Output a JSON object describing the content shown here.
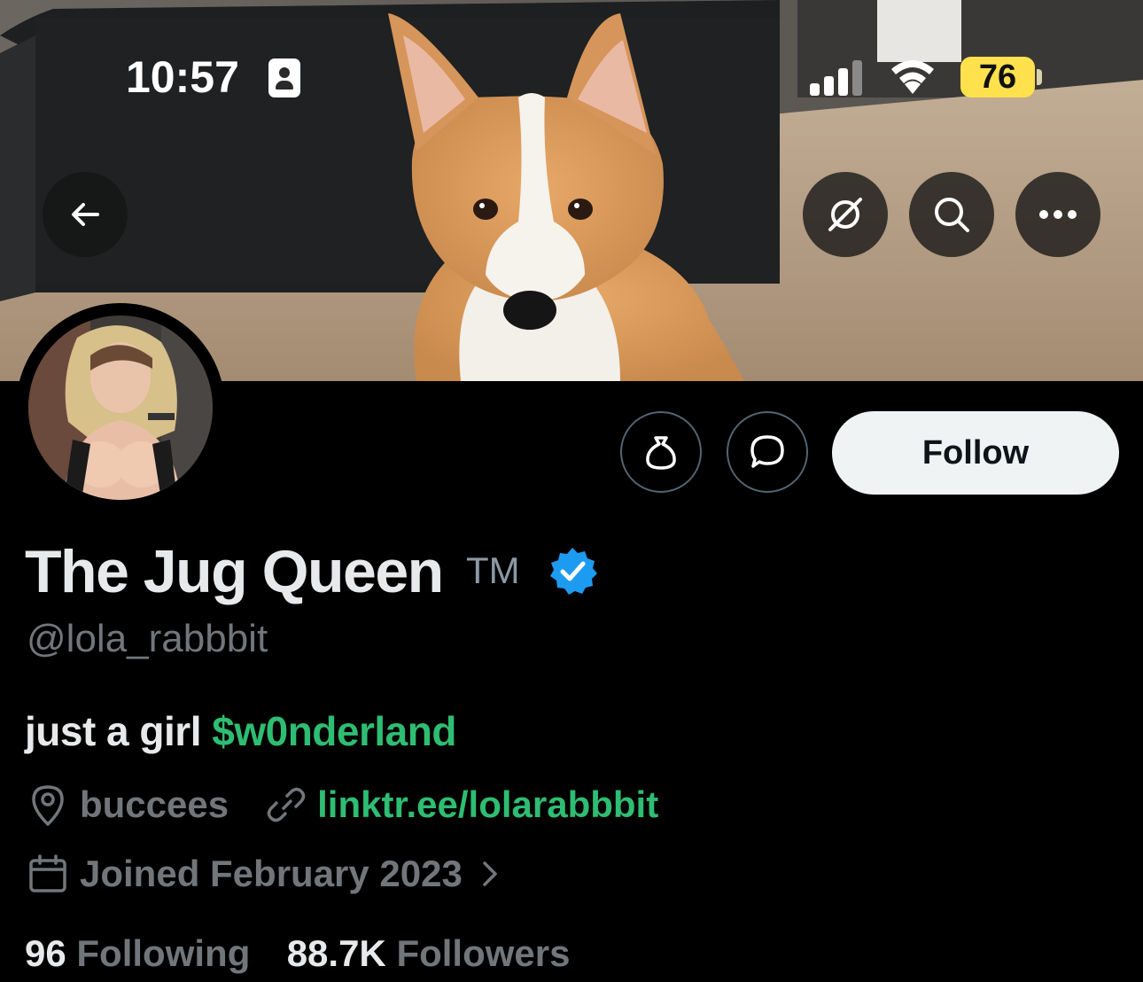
{
  "status_bar": {
    "time": "10:57",
    "battery_percent": "76",
    "badge_icon": "person-badge-icon",
    "signal_icon": "cellular-signal-icon",
    "wifi_icon": "wifi-icon"
  },
  "header": {
    "back_icon": "back-arrow-icon",
    "grok_icon": "grok-icon",
    "search_icon": "search-icon",
    "more_icon": "more-icon"
  },
  "profile": {
    "display_name": "The Jug Queen",
    "trademark": "TM",
    "verified": true,
    "handle": "@lola_rabbbit",
    "bio_text": "just a girl ",
    "bio_cashtag": "$w0nderland",
    "location": "buccees",
    "link": "linktr.ee/lolarabbbit",
    "joined": "Joined February 2023",
    "following_count": "96",
    "following_label": "Following",
    "followers_count": "88.7K",
    "followers_label": "Followers"
  },
  "actions": {
    "subscribe_icon": "money-bag-icon",
    "message_icon": "message-bubble-icon",
    "follow_label": "Follow"
  },
  "colors": {
    "background": "#000000",
    "primary_text": "#e7e9ea",
    "secondary_text": "#71767b",
    "link": "#2ebd72",
    "verified_badge": "#1d9bf0",
    "follow_button_bg": "#eff3f4",
    "battery": "#ffe14d"
  }
}
